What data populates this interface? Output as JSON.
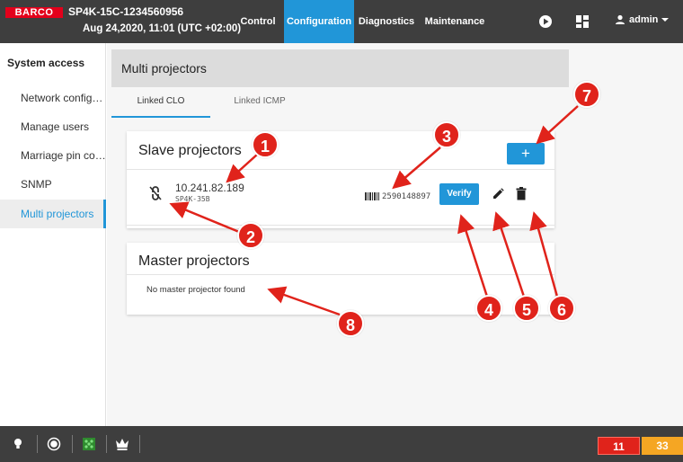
{
  "header": {
    "logo": "BARCO",
    "device_name": "SP4K-15C-1234560956",
    "date": "Aug 24,2020, 11:01 (UTC +02:00)",
    "nav": [
      {
        "label": "Control",
        "active": false
      },
      {
        "label": "Configuration",
        "active": true
      },
      {
        "label": "Diagnostics",
        "active": false
      },
      {
        "label": "Maintenance",
        "active": false
      }
    ],
    "user": "admin",
    "icons": [
      "play-icon",
      "layout-icon",
      "user-icon"
    ]
  },
  "sidebar": {
    "heading": "System access",
    "items": [
      {
        "label": "Network configur...",
        "active": false
      },
      {
        "label": "Manage users",
        "active": false
      },
      {
        "label": "Marriage pin code",
        "active": false
      },
      {
        "label": "SNMP",
        "active": false
      },
      {
        "label": "Multi projectors",
        "active": true
      }
    ]
  },
  "main": {
    "title": "Multi projectors",
    "tabs": [
      {
        "label": "Linked CLO",
        "active": true
      },
      {
        "label": "Linked ICMP",
        "active": false
      }
    ],
    "slave": {
      "title": "Slave projectors",
      "add_label": "+",
      "projector": {
        "ip": "10.241.82.189",
        "model": "SP4K-35B",
        "serial": "2590148897",
        "verify_label": "Verify"
      }
    },
    "master": {
      "title": "Master projectors",
      "empty": "No master projector found"
    }
  },
  "footer": {
    "icons": [
      "bulb-icon",
      "shutter-icon",
      "dmx-icon",
      "crown-icon"
    ],
    "error_count": "11",
    "warning_count": "33",
    "colors": {
      "error": "#e0231b",
      "warning": "#f5a623"
    }
  },
  "callouts": [
    "1",
    "2",
    "3",
    "4",
    "5",
    "6",
    "7",
    "8"
  ],
  "colors": {
    "accent": "#2196d8",
    "brand": "#e3001b",
    "callout": "#e0231b"
  }
}
